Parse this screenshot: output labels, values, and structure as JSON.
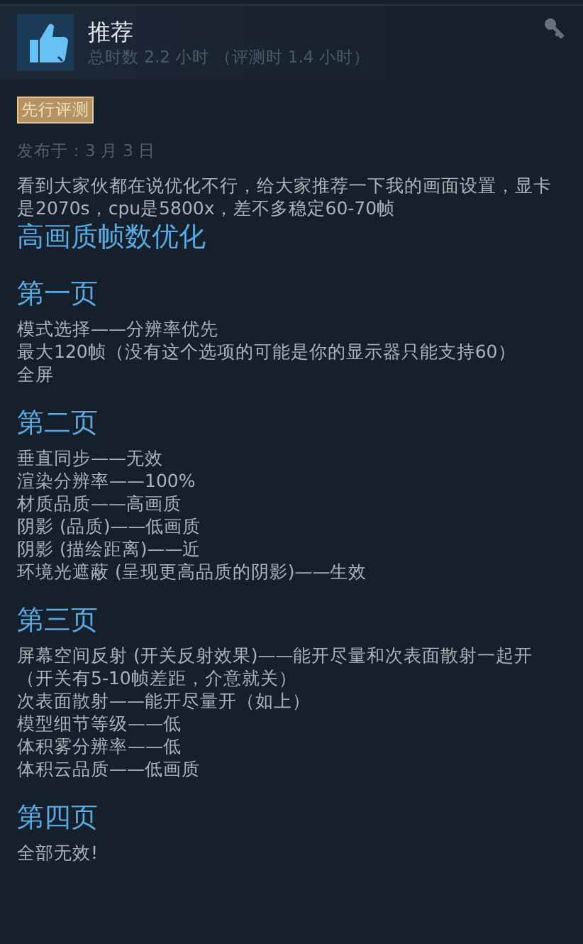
{
  "review": {
    "verdict": "推荐",
    "recommended": true,
    "hours": "总时数 2.2 小时 （评测时 1.4 小时）",
    "badge": "先行评测",
    "posted": "发布于：3 月 3 日",
    "intro": "看到大家伙都在说优化不行，给大家推荐一下我的画面设置，显卡是2070s，cpu是5800x，差不多稳定60-70帧",
    "title": "高画质帧数优化",
    "sections": [
      {
        "heading": "第一页",
        "lines": [
          "模式选择——分辨率优先",
          "最大120帧（没有这个选项的可能是你的显示器只能支持60）",
          "全屏"
        ]
      },
      {
        "heading": "第二页",
        "lines": [
          "垂直同步——无效",
          "渲染分辨率——100%",
          "材质品质——高画质",
          "阴影 (品质)——低画质",
          "阴影 (描绘距离)——近",
          "环境光遮蔽 (呈现更高品质的阴影)——生效"
        ]
      },
      {
        "heading": "第三页",
        "lines": [
          "屏幕空间反射 (开关反射效果)——能开尽量和次表面散射一起开（开关有5-10帧差距，介意就关）",
          "次表面散射——能开尽量开（如上）",
          "模型细节等级——低",
          "体积雾分辨率——低",
          "体积云品质——低画质"
        ]
      },
      {
        "heading": "第四页",
        "lines": [
          "全部无效!"
        ]
      }
    ]
  }
}
